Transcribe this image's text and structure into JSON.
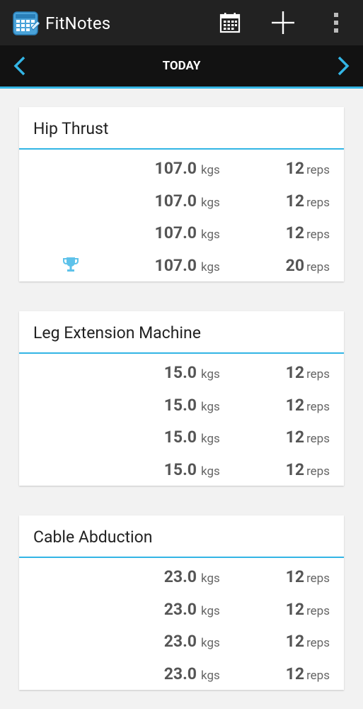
{
  "app": {
    "title": "FitNotes",
    "icon": "calendar-app-icon"
  },
  "actions": {
    "calendar_icon": "calendar-icon",
    "add_icon": "plus-icon",
    "more_icon": "overflow-menu-icon"
  },
  "date_nav": {
    "label": "TODAY",
    "prev_icon": "chevron-left-icon",
    "next_icon": "chevron-right-icon"
  },
  "colors": {
    "accent": "#33b5e5",
    "appbar": "#222222",
    "datebar": "#121212"
  },
  "exercises": [
    {
      "name": "Hip Thrust",
      "sets": [
        {
          "weight": "107.0",
          "weight_unit": "kgs",
          "reps": "12",
          "reps_unit": "reps",
          "pr": false
        },
        {
          "weight": "107.0",
          "weight_unit": "kgs",
          "reps": "12",
          "reps_unit": "reps",
          "pr": false
        },
        {
          "weight": "107.0",
          "weight_unit": "kgs",
          "reps": "12",
          "reps_unit": "reps",
          "pr": false
        },
        {
          "weight": "107.0",
          "weight_unit": "kgs",
          "reps": "20",
          "reps_unit": "reps",
          "pr": true
        }
      ]
    },
    {
      "name": "Leg Extension Machine",
      "sets": [
        {
          "weight": "15.0",
          "weight_unit": "kgs",
          "reps": "12",
          "reps_unit": "reps",
          "pr": false
        },
        {
          "weight": "15.0",
          "weight_unit": "kgs",
          "reps": "12",
          "reps_unit": "reps",
          "pr": false
        },
        {
          "weight": "15.0",
          "weight_unit": "kgs",
          "reps": "12",
          "reps_unit": "reps",
          "pr": false
        },
        {
          "weight": "15.0",
          "weight_unit": "kgs",
          "reps": "12",
          "reps_unit": "reps",
          "pr": false
        }
      ]
    },
    {
      "name": "Cable Abduction",
      "sets": [
        {
          "weight": "23.0",
          "weight_unit": "kgs",
          "reps": "12",
          "reps_unit": "reps",
          "pr": false
        },
        {
          "weight": "23.0",
          "weight_unit": "kgs",
          "reps": "12",
          "reps_unit": "reps",
          "pr": false
        },
        {
          "weight": "23.0",
          "weight_unit": "kgs",
          "reps": "12",
          "reps_unit": "reps",
          "pr": false
        },
        {
          "weight": "23.0",
          "weight_unit": "kgs",
          "reps": "12",
          "reps_unit": "reps",
          "pr": false
        }
      ]
    }
  ]
}
